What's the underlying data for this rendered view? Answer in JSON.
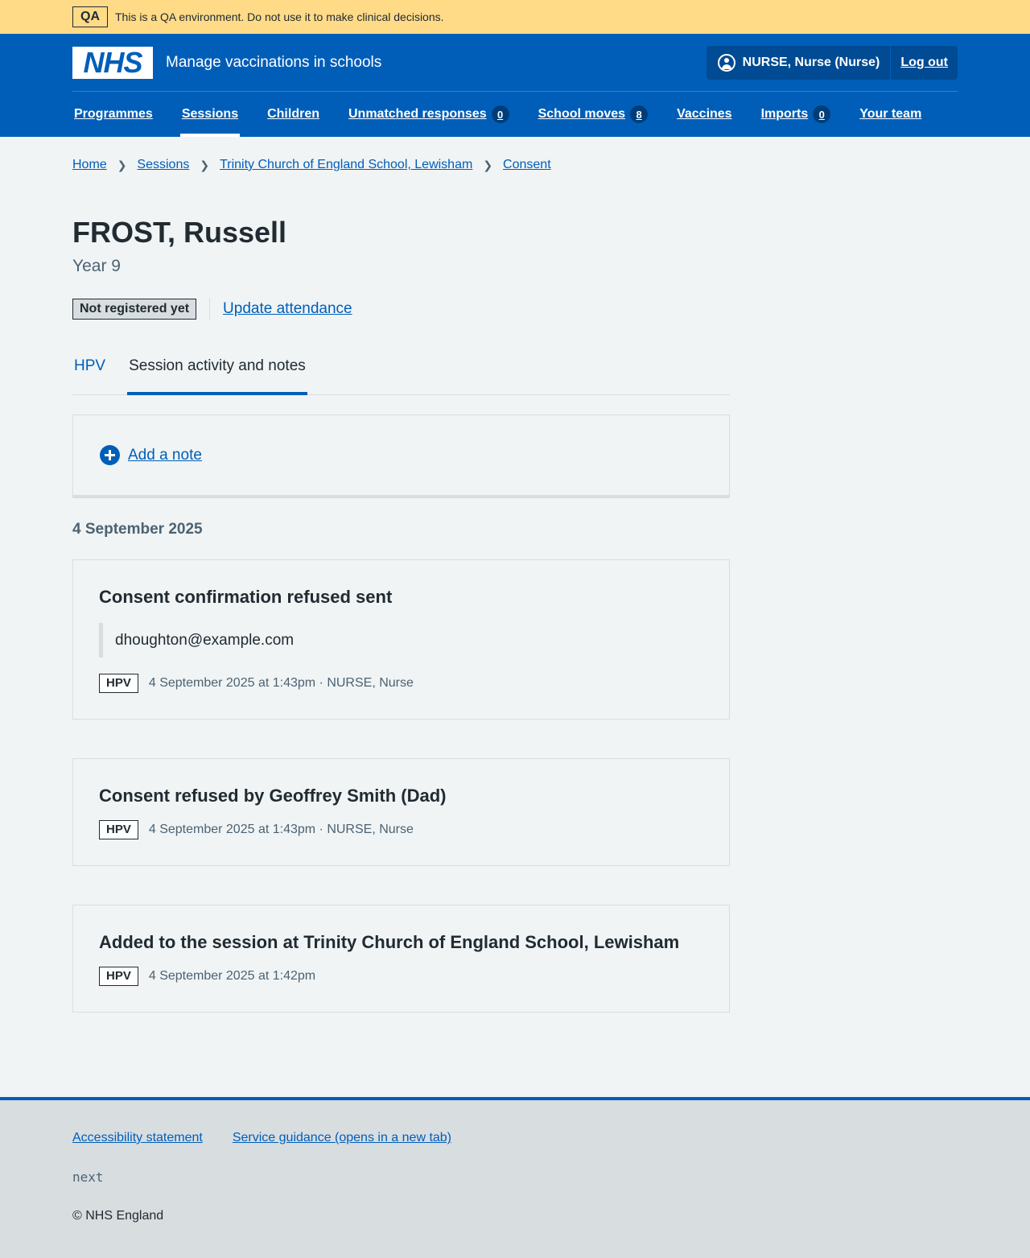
{
  "qa_banner": {
    "tag": "QA",
    "text": "This is a QA environment. Do not use it to make clinical decisions."
  },
  "header": {
    "logo_text": "NHS",
    "service_name": "Manage vaccinations in schools",
    "user_name": "NURSE, Nurse (Nurse)",
    "logout_label": "Log out"
  },
  "nav": {
    "items": [
      {
        "label": "Programmes"
      },
      {
        "label": "Sessions",
        "current": true
      },
      {
        "label": "Children"
      },
      {
        "label": "Unmatched responses",
        "count": "0"
      },
      {
        "label": "School moves",
        "count": "8"
      },
      {
        "label": "Vaccines"
      },
      {
        "label": "Imports",
        "count": "0"
      },
      {
        "label": "Your team"
      }
    ]
  },
  "breadcrumb": [
    "Home",
    "Sessions",
    "Trinity Church of England School, Lewisham",
    "Consent"
  ],
  "page": {
    "title": "FROST, Russell",
    "caption": "Year 9",
    "status_tag": "Not registered yet",
    "update_attendance": "Update attendance"
  },
  "tabs": [
    {
      "label": "HPV",
      "selected": false
    },
    {
      "label": "Session activity and notes",
      "selected": true
    }
  ],
  "add_note_label": "Add a note",
  "activity": {
    "date_heading": "4 September 2025",
    "events": [
      {
        "title": "Consent confirmation refused sent",
        "quote": "dhoughton@example.com",
        "programme": "HPV",
        "meta": "4 September 2025 at 1:43pm · NURSE, Nurse"
      },
      {
        "title": "Consent refused by Geoffrey Smith (Dad)",
        "programme": "HPV",
        "meta": "4 September 2025 at 1:43pm · NURSE, Nurse"
      },
      {
        "title": "Added to the session at Trinity Church of England School, Lewisham",
        "programme": "HPV",
        "meta": "4 September 2025 at 1:42pm"
      }
    ]
  },
  "footer": {
    "links": [
      "Accessibility statement",
      "Service guidance (opens in a new tab)"
    ],
    "version": "next",
    "copyright": "© NHS England"
  },
  "colors": {
    "nhs_blue": "#005eb8",
    "qa_yellow": "#ffdb88",
    "page_bg": "#f0f4f5",
    "footer_bg": "#d8dde0"
  }
}
